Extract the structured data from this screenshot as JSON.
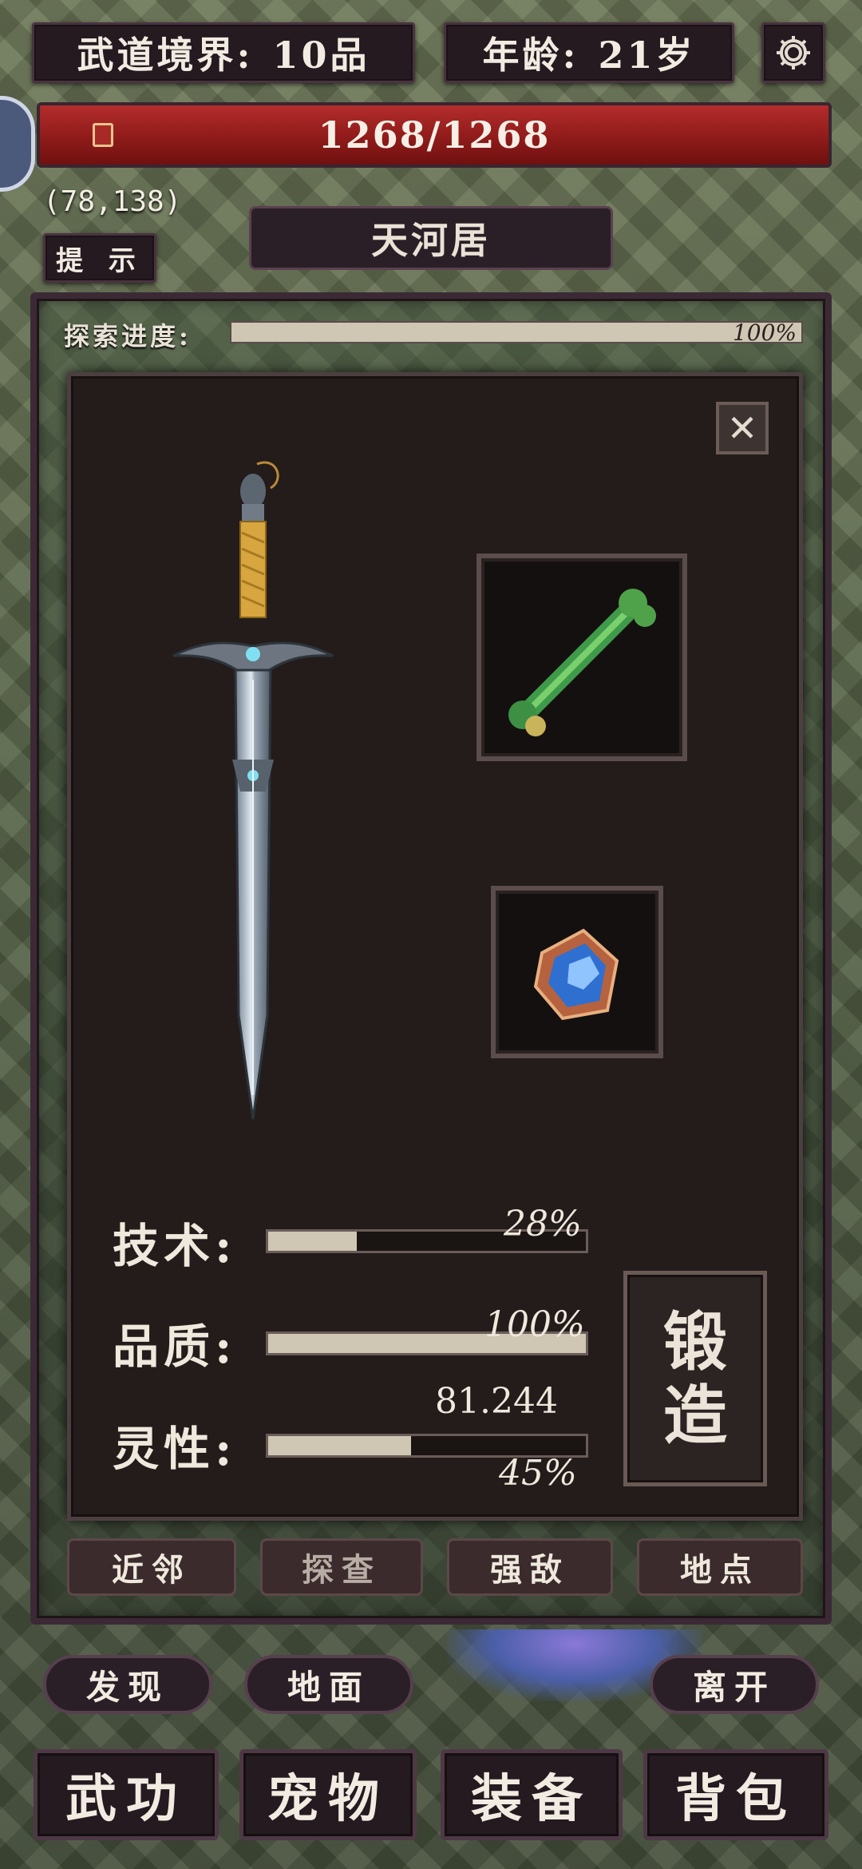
{
  "header": {
    "realm_label": "武道境界:",
    "realm_value": "10品",
    "age_label": "年龄:",
    "age_value": "21岁"
  },
  "hp": {
    "text": "1268/1268",
    "fraction": 1.0
  },
  "coords": "(78,138)",
  "hint_label": "提 示",
  "location_name": "天河居",
  "exploration": {
    "label": "探索进度:",
    "percent_text": "100%",
    "fraction": 1.0
  },
  "forge_panel": {
    "close_glyph": "✕",
    "stats": [
      {
        "label": "技术:",
        "percent_text": "28%",
        "fraction": 0.28
      },
      {
        "label": "品质:",
        "percent_text": "100%",
        "fraction": 1.0
      },
      {
        "label": "灵性:",
        "value_text": "81.244",
        "percent_text": "45%",
        "fraction": 0.45
      }
    ],
    "forge_button": {
      "line1": "锻",
      "line2": "造"
    }
  },
  "tabs": [
    "近邻",
    "探查",
    "强敌",
    "地点"
  ],
  "actions": [
    "发现",
    "地面",
    "离开"
  ],
  "nav": [
    "武功",
    "宠物",
    "装备",
    "背包"
  ],
  "colors": {
    "hp_red": "#a82322",
    "panel_bg": "#231c1b",
    "frame": "#3b2a36",
    "bar_fill": "#cfc6b3"
  },
  "icons": {
    "settings": "gear-icon",
    "sword": "sword-icon",
    "material1": "green-bone-icon",
    "material2": "blue-gem-icon"
  }
}
